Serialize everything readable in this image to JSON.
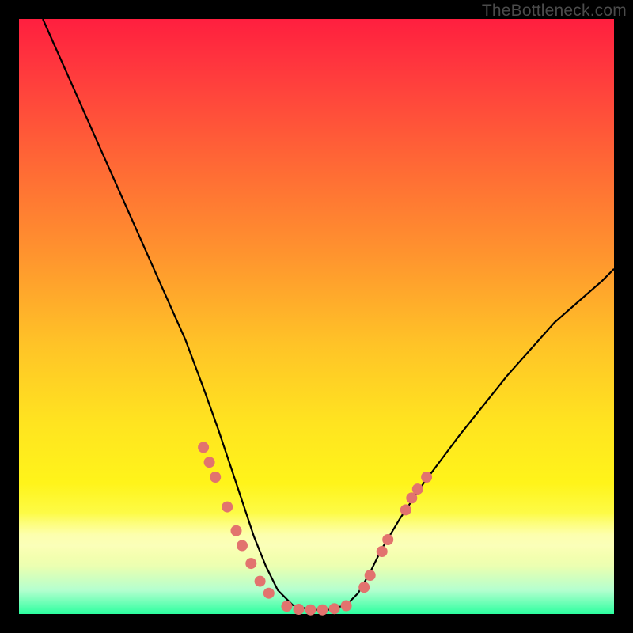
{
  "watermark": "TheBottleneck.com",
  "colors": {
    "dot": "#e2736e",
    "line": "#000000",
    "frame": "#000000"
  },
  "chart_data": {
    "type": "line",
    "title": "",
    "xlabel": "",
    "ylabel": "",
    "xlim": [
      0,
      100
    ],
    "ylim": [
      0,
      100
    ],
    "series": [
      {
        "name": "curve",
        "x": [
          4,
          8,
          12,
          16,
          20,
          24,
          28,
          31,
          33.5,
          35.5,
          37.5,
          39.5,
          41.5,
          43.5,
          46,
          49,
          52,
          55,
          57,
          59,
          61,
          64,
          68,
          74,
          82,
          90,
          98,
          100
        ],
        "y": [
          100,
          91,
          82,
          73,
          64,
          55,
          46,
          38,
          31,
          25,
          19,
          13,
          8,
          4,
          1.5,
          0.7,
          0.7,
          1.5,
          3.5,
          7,
          11,
          16,
          22,
          30,
          40,
          49,
          56,
          58
        ]
      }
    ],
    "points": [
      {
        "x": 31.0,
        "y": 28.0
      },
      {
        "x": 32.0,
        "y": 25.5
      },
      {
        "x": 33.0,
        "y": 23.0
      },
      {
        "x": 35.0,
        "y": 18.0
      },
      {
        "x": 36.5,
        "y": 14.0
      },
      {
        "x": 37.5,
        "y": 11.5
      },
      {
        "x": 39.0,
        "y": 8.5
      },
      {
        "x": 40.5,
        "y": 5.5
      },
      {
        "x": 42.0,
        "y": 3.5
      },
      {
        "x": 45.0,
        "y": 1.3
      },
      {
        "x": 47.0,
        "y": 0.8
      },
      {
        "x": 49.0,
        "y": 0.7
      },
      {
        "x": 51.0,
        "y": 0.7
      },
      {
        "x": 53.0,
        "y": 0.9
      },
      {
        "x": 55.0,
        "y": 1.4
      },
      {
        "x": 58.0,
        "y": 4.5
      },
      {
        "x": 59.0,
        "y": 6.5
      },
      {
        "x": 61.0,
        "y": 10.5
      },
      {
        "x": 62.0,
        "y": 12.5
      },
      {
        "x": 65.0,
        "y": 17.5
      },
      {
        "x": 66.0,
        "y": 19.5
      },
      {
        "x": 67.0,
        "y": 21.0
      },
      {
        "x": 68.5,
        "y": 23.0
      }
    ]
  }
}
